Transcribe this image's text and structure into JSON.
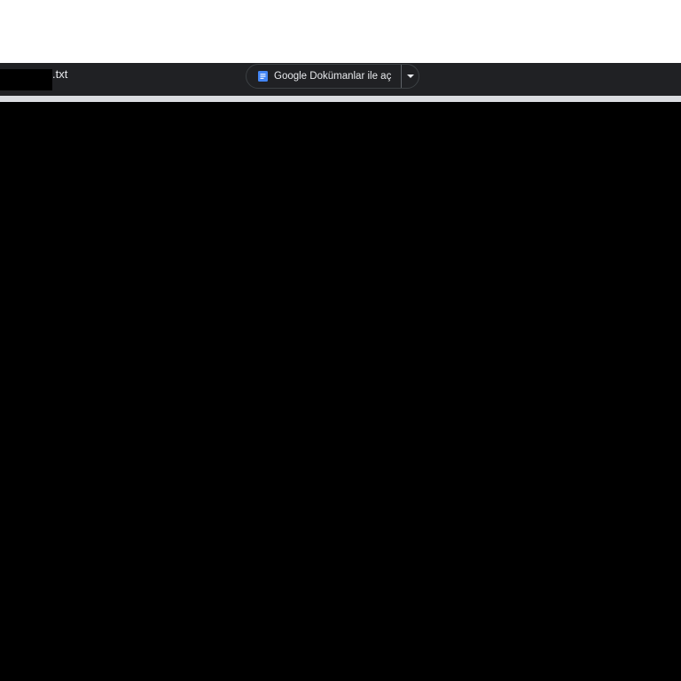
{
  "toolbar": {
    "file_extension": ".txt",
    "open_with_label": "Google Dokümanlar ile aç"
  },
  "icons": {
    "docs": "google-docs-icon",
    "dropdown": "caret-down-icon"
  },
  "colors": {
    "toolbar_bg": "#202124",
    "docs_blue": "#4285f4",
    "content_bg": "#000000"
  }
}
